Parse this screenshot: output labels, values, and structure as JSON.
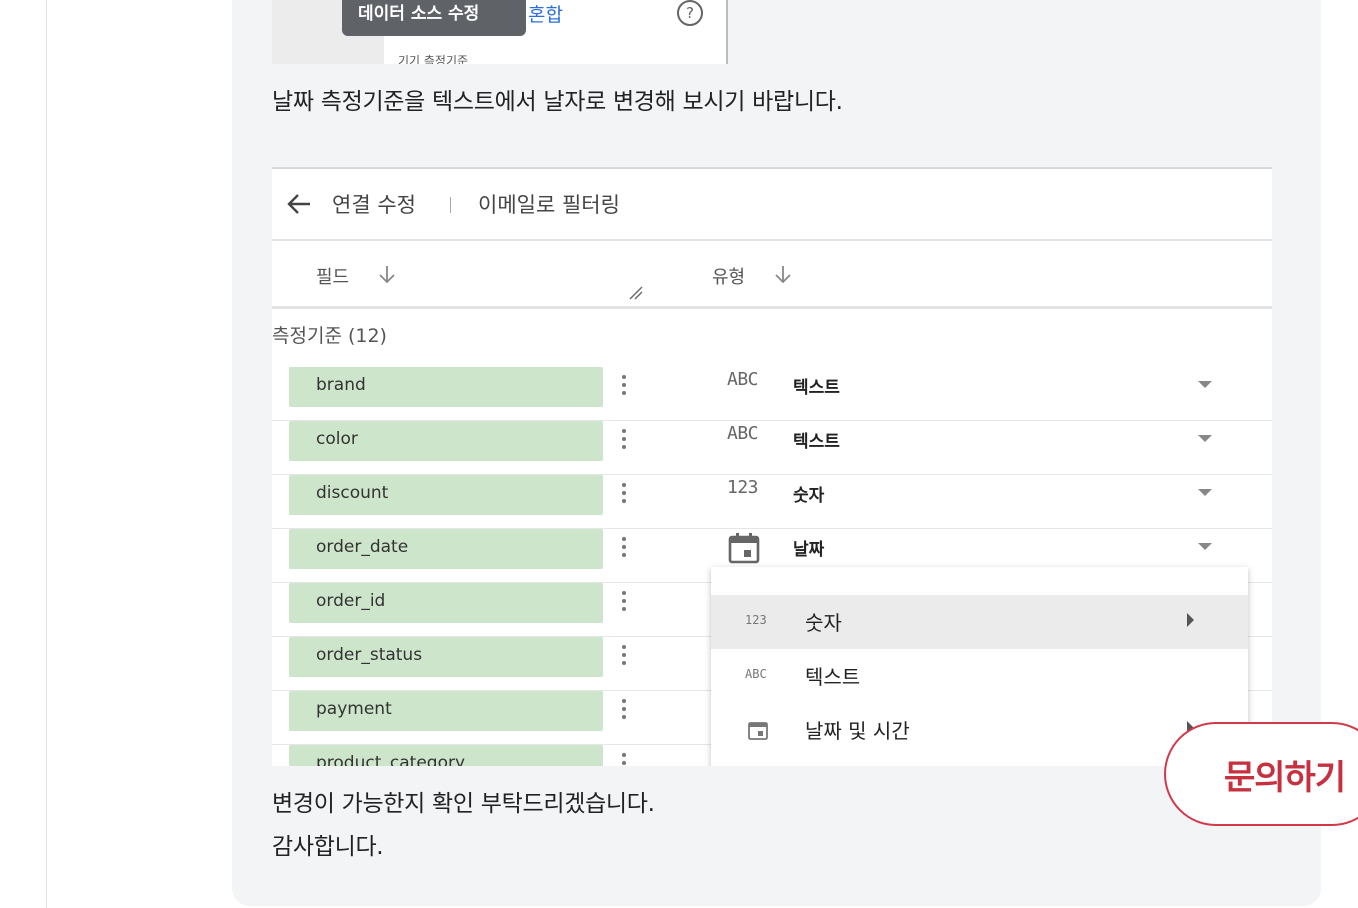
{
  "top_shot": {
    "tooltip": "데이터 소스 수정",
    "mix_label": "혼합",
    "help_glyph": "?",
    "faint_text": "기기 측정기준"
  },
  "paragraphs": {
    "instruction": "날짜 측정기준을 텍스트에서 날자로 변경해 보시기 바랍니다.",
    "confirm": "변경이 가능한지 확인 부탁드리겠습니다.",
    "thanks": "감사합니다."
  },
  "editor": {
    "header": {
      "edit_connection": "연결 수정",
      "filter_by_email": "이메일로 필터링"
    },
    "columns": {
      "field": "필드",
      "type": "유형"
    },
    "section_label": "측정기준 (12)",
    "rows": [
      {
        "field": "brand",
        "type_icon": "ABC",
        "type": "텍스트"
      },
      {
        "field": "color",
        "type_icon": "ABC",
        "type": "텍스트"
      },
      {
        "field": "discount",
        "type_icon": "123",
        "type": "숫자"
      },
      {
        "field": "order_date",
        "type_icon": "calendar-icon",
        "type": "날짜"
      },
      {
        "field": "order_id"
      },
      {
        "field": "order_status"
      },
      {
        "field": "payment"
      },
      {
        "field": "product_category"
      }
    ],
    "menu": [
      {
        "icon": "123",
        "label": "숫자",
        "highlighted": true
      },
      {
        "icon": "ABC",
        "label": "텍스트"
      },
      {
        "icon": "calendar-icon",
        "label": "날짜 및 시간"
      }
    ]
  },
  "inquiry_button": "문의하기",
  "colors": {
    "chip_green": "#cde5ca",
    "accent_red": "#c6303f",
    "card_bg": "#f3f4f6"
  }
}
